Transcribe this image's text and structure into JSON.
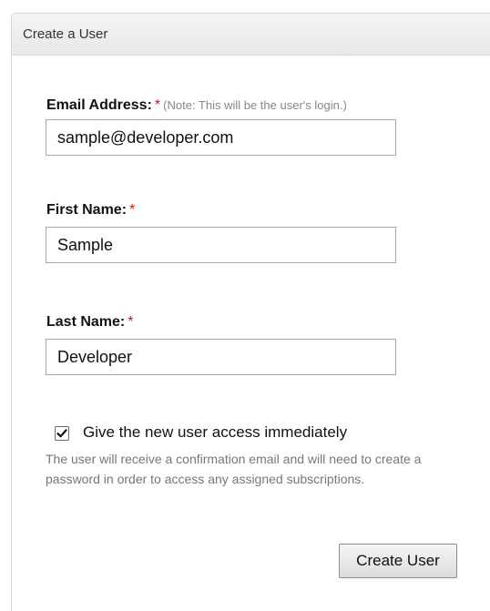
{
  "panel": {
    "title": "Create a User"
  },
  "form": {
    "email": {
      "label": "Email Address:",
      "required_marker": "*",
      "note": "(Note: This will be the user's login.)",
      "value": "sample@developer.com"
    },
    "first_name": {
      "label": "First Name:",
      "required_marker": "*",
      "value": "Sample"
    },
    "last_name": {
      "label": "Last Name:",
      "required_marker": "*",
      "value": "Developer"
    },
    "access": {
      "checked": true,
      "label": "Give the new user access immediately",
      "help": "The user will receive a confirmation email and will need to create a password in order to access any assigned subscriptions."
    },
    "submit_label": "Create User"
  },
  "colors": {
    "required": "#dd1111",
    "header_bg": "#ececec",
    "border": "#d6d6d6"
  },
  "icons": {
    "checkbox_mark": "checkmark-icon"
  }
}
